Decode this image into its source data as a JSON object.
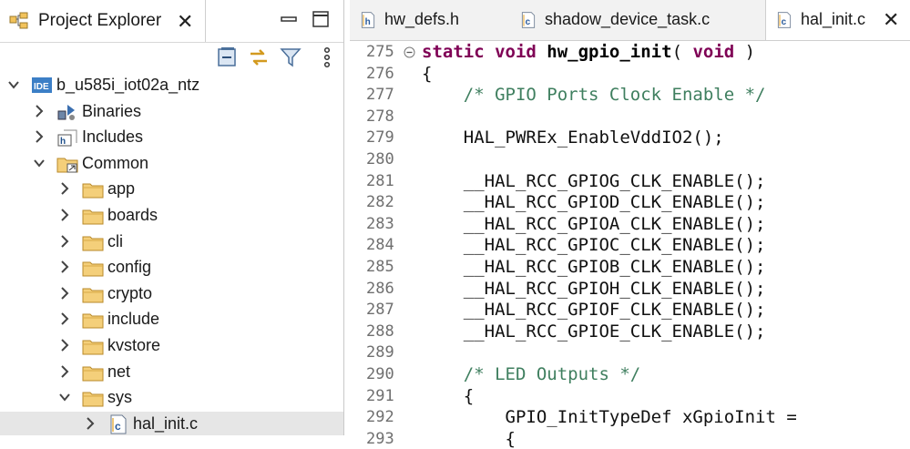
{
  "project_explorer": {
    "tab_title": "Project Explorer",
    "tree": [
      {
        "label": "b_u585i_iot02a_ntz",
        "depth": 0,
        "expanded": true,
        "icon": "project-ide-icon"
      },
      {
        "label": "Binaries",
        "depth": 1,
        "expanded": false,
        "icon": "binaries-icon"
      },
      {
        "label": "Includes",
        "depth": 1,
        "expanded": false,
        "icon": "includes-icon"
      },
      {
        "label": "Common",
        "depth": 1,
        "expanded": true,
        "icon": "linked-folder-icon"
      },
      {
        "label": "app",
        "depth": 2,
        "expanded": false,
        "icon": "folder-icon"
      },
      {
        "label": "boards",
        "depth": 2,
        "expanded": false,
        "icon": "folder-icon"
      },
      {
        "label": "cli",
        "depth": 2,
        "expanded": false,
        "icon": "folder-icon"
      },
      {
        "label": "config",
        "depth": 2,
        "expanded": false,
        "icon": "folder-icon"
      },
      {
        "label": "crypto",
        "depth": 2,
        "expanded": false,
        "icon": "folder-icon"
      },
      {
        "label": "include",
        "depth": 2,
        "expanded": false,
        "icon": "folder-icon"
      },
      {
        "label": "kvstore",
        "depth": 2,
        "expanded": false,
        "icon": "folder-icon"
      },
      {
        "label": "net",
        "depth": 2,
        "expanded": false,
        "icon": "folder-icon"
      },
      {
        "label": "sys",
        "depth": 2,
        "expanded": true,
        "icon": "folder-icon"
      },
      {
        "label": "hal_init.c",
        "depth": 3,
        "expanded": false,
        "icon": "c-file-icon",
        "selected": true
      }
    ]
  },
  "editor": {
    "tabs": [
      {
        "label": "hw_defs.h",
        "icon": "h-file-icon",
        "active": false
      },
      {
        "label": "shadow_device_task.c",
        "icon": "c-file-icon",
        "active": false
      },
      {
        "label": "hal_init.c",
        "icon": "c-file-icon",
        "active": true
      }
    ],
    "lines": [
      {
        "num": "275",
        "fold": true,
        "parts": [
          {
            "t": "static ",
            "c": "kw"
          },
          {
            "t": "void ",
            "c": "kw"
          },
          {
            "t": "hw_gpio_init",
            "c": "fn"
          },
          {
            "t": "( ",
            "c": ""
          },
          {
            "t": "void",
            "c": "kw"
          },
          {
            "t": " )",
            "c": ""
          }
        ]
      },
      {
        "num": "276",
        "parts": [
          {
            "t": "{",
            "c": ""
          }
        ]
      },
      {
        "num": "277",
        "parts": [
          {
            "t": "    /* GPIO Ports Clock Enable */",
            "c": "cm"
          }
        ]
      },
      {
        "num": "278",
        "parts": []
      },
      {
        "num": "279",
        "parts": [
          {
            "t": "    HAL_PWREx_EnableVddIO2();",
            "c": ""
          }
        ]
      },
      {
        "num": "280",
        "parts": []
      },
      {
        "num": "281",
        "parts": [
          {
            "t": "    __HAL_RCC_GPIOG_CLK_ENABLE();",
            "c": ""
          }
        ]
      },
      {
        "num": "282",
        "parts": [
          {
            "t": "    __HAL_RCC_GPIOD_CLK_ENABLE();",
            "c": ""
          }
        ]
      },
      {
        "num": "283",
        "parts": [
          {
            "t": "    __HAL_RCC_GPIOA_CLK_ENABLE();",
            "c": ""
          }
        ]
      },
      {
        "num": "284",
        "parts": [
          {
            "t": "    __HAL_RCC_GPIOC_CLK_ENABLE();",
            "c": ""
          }
        ]
      },
      {
        "num": "285",
        "parts": [
          {
            "t": "    __HAL_RCC_GPIOB_CLK_ENABLE();",
            "c": ""
          }
        ]
      },
      {
        "num": "286",
        "parts": [
          {
            "t": "    __HAL_RCC_GPIOH_CLK_ENABLE();",
            "c": ""
          }
        ]
      },
      {
        "num": "287",
        "parts": [
          {
            "t": "    __HAL_RCC_GPIOF_CLK_ENABLE();",
            "c": ""
          }
        ]
      },
      {
        "num": "288",
        "parts": [
          {
            "t": "    __HAL_RCC_GPIOE_CLK_ENABLE();",
            "c": ""
          }
        ]
      },
      {
        "num": "289",
        "parts": []
      },
      {
        "num": "290",
        "parts": [
          {
            "t": "    /* LED Outputs */",
            "c": "cm"
          }
        ]
      },
      {
        "num": "291",
        "parts": [
          {
            "t": "    {",
            "c": ""
          }
        ]
      },
      {
        "num": "292",
        "parts": [
          {
            "t": "        GPIO_InitTypeDef xGpioInit =",
            "c": ""
          }
        ]
      },
      {
        "num": "293",
        "parts": [
          {
            "t": "        {",
            "c": ""
          }
        ]
      }
    ]
  },
  "colors": {
    "keyword": "#7f0055",
    "comment": "#3f7f5f",
    "line_number": "#6f6f6f",
    "selection": "#e6e6e6",
    "folder": "#e9b44c"
  }
}
